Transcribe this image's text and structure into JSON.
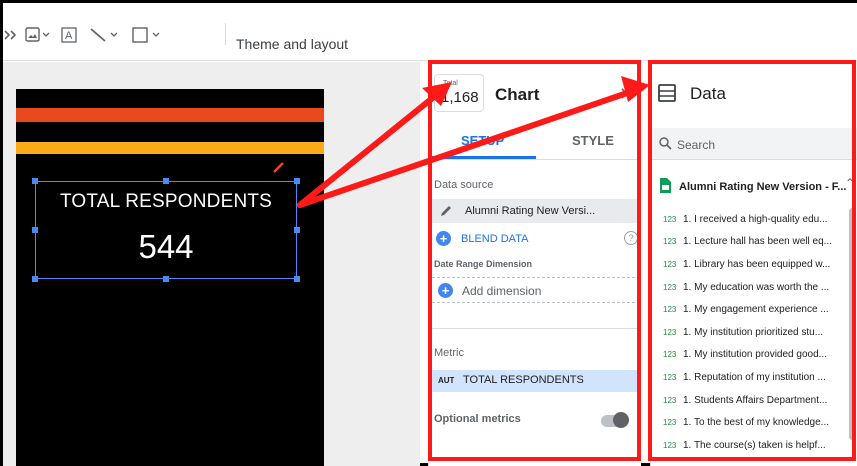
{
  "toolbar": {
    "theme_label": "Theme and layout",
    "icons": [
      "chevron-right-icon",
      "image-icon",
      "text-icon",
      "line-icon",
      "rectangle-icon"
    ]
  },
  "scorecard": {
    "label": "TOTAL RESPONDENTS",
    "value": "544",
    "colors": {
      "orange": "#e8491d",
      "yellow": "#fbab18",
      "background": "#000000"
    }
  },
  "chart_panel": {
    "chip_label": "Total",
    "chip_value": "1,168",
    "title": "Chart",
    "tabs": [
      "SETUP",
      "STYLE"
    ],
    "active_tab": "SETUP",
    "data_source_label": "Data source",
    "data_source_value": "Alumni Rating New Versi...",
    "blend_label": "BLEND DATA",
    "help_icon": "?",
    "date_range_label": "Date Range Dimension",
    "add_dimension_label": "Add dimension",
    "metric_label": "Metric",
    "metric_type": "AUT",
    "metric_value": "TOTAL RESPONDENTS",
    "optional_metrics_label": "Optional metrics"
  },
  "data_panel": {
    "title": "Data",
    "search_placeholder": "Search",
    "source_name": "Alumni Rating New Version - F...",
    "field_type": "123",
    "fields": [
      "1. I received a high-quality edu...",
      "1. Lecture hall has been well eq...",
      "1. Library has been equipped w...",
      "1. My education was worth the ...",
      "1. My engagement experience ...",
      "1. My institution prioritized stu...",
      "1. My institution provided good...",
      "1. Reputation of my institution ...",
      "1. Students Affairs Department...",
      "1. To the best of my knowledge...",
      "1. The course(s) taken is helpf..."
    ]
  },
  "annotation_color": "#ff1a1a"
}
